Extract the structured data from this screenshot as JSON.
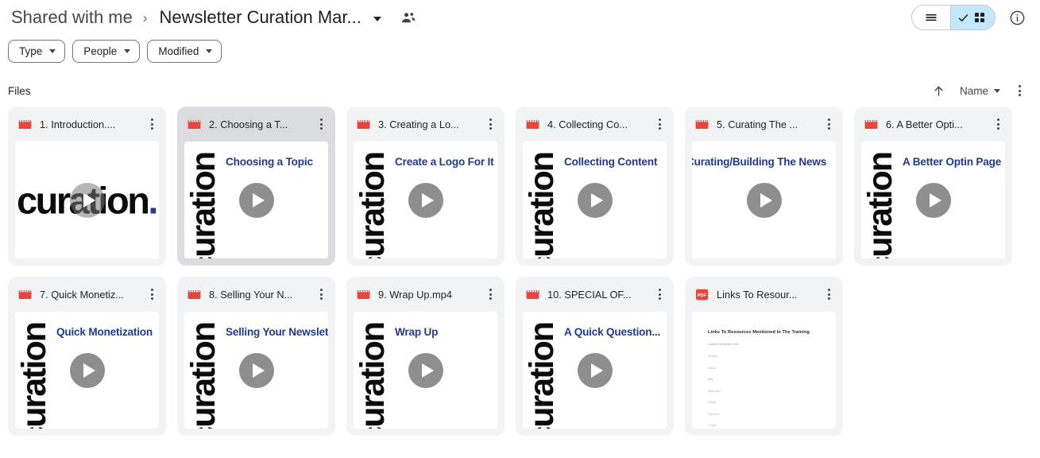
{
  "header": {
    "breadcrumb_root": "Shared with me",
    "breadcrumb_separator": "›",
    "breadcrumb_current": "Newsletter Curation Mar...",
    "people_icon": "people-shared-icon",
    "view_list_icon": "list-view-icon",
    "view_grid_icon": "grid-view-icon",
    "view_grid_selected": true,
    "info_icon": "info-circle-icon"
  },
  "filters": [
    {
      "label": "Type",
      "name": "type"
    },
    {
      "label": "People",
      "name": "people"
    },
    {
      "label": "Modified",
      "name": "modified"
    }
  ],
  "section": {
    "title": "Files",
    "sort_direction_icon": "arrow-up-icon",
    "sort_label": "Name",
    "more_icon": "kebab-menu-icon"
  },
  "files": [
    {
      "name": "1. Introduction....",
      "type_icon": "video-file-icon",
      "selected": false,
      "thumb": {
        "kind": "video",
        "variant": "wordmark-horizontal",
        "wordmark": "curation",
        "title": ""
      }
    },
    {
      "name": "2. Choosing a T...",
      "type_icon": "video-file-icon",
      "selected": true,
      "thumb": {
        "kind": "video",
        "variant": "slide",
        "wordmark": "curation",
        "title": "Choosing a Topic"
      }
    },
    {
      "name": "3. Creating a Lo...",
      "type_icon": "video-file-icon",
      "selected": false,
      "thumb": {
        "kind": "video",
        "variant": "slide",
        "wordmark": "curation",
        "title": "Create a Logo For It"
      }
    },
    {
      "name": "4. Collecting Co...",
      "type_icon": "video-file-icon",
      "selected": false,
      "thumb": {
        "kind": "video",
        "variant": "slide",
        "wordmark": "curation",
        "title": "Collecting Content"
      }
    },
    {
      "name": "5. Curating The ...",
      "type_icon": "video-file-icon",
      "selected": false,
      "thumb": {
        "kind": "video",
        "variant": "shift",
        "wordmark": "",
        "title": "Curating/Building The News"
      }
    },
    {
      "name": "6. A Better Opti...",
      "type_icon": "video-file-icon",
      "selected": false,
      "thumb": {
        "kind": "video",
        "variant": "slide",
        "wordmark": "curation",
        "title": "A Better Optin Page"
      }
    },
    {
      "name": "7. Quick Monetiz...",
      "type_icon": "video-file-icon",
      "selected": false,
      "thumb": {
        "kind": "video",
        "variant": "slide",
        "wordmark": "curation",
        "title": "Quick Monetization"
      }
    },
    {
      "name": "8. Selling Your N...",
      "type_icon": "video-file-icon",
      "selected": false,
      "thumb": {
        "kind": "video",
        "variant": "slide",
        "wordmark": "curation",
        "title": "Selling Your Newslett"
      }
    },
    {
      "name": "9. Wrap Up.mp4",
      "type_icon": "video-file-icon",
      "selected": false,
      "thumb": {
        "kind": "video",
        "variant": "slide",
        "wordmark": "curation",
        "title": "Wrap Up"
      }
    },
    {
      "name": "10. SPECIAL OF...",
      "type_icon": "video-file-icon",
      "selected": false,
      "thumb": {
        "kind": "video",
        "variant": "slide",
        "wordmark": "curation",
        "title": "A Quick Question..."
      }
    },
    {
      "name": "Links To Resour...",
      "type_icon": "pdf-file-icon",
      "selected": false,
      "thumb": {
        "kind": "pdf",
        "heading": "Links To Resources Mentioned In The Training",
        "subheading": "Curation Newsletter Links",
        "lines": [
          "Pixabay",
          "Canva",
          "Bitly",
          "MailChimp",
          "Feedly",
          "Flipboard",
          "Google"
        ]
      }
    }
  ],
  "colors": {
    "accent_selected": "#c2e7ff",
    "video_icon": "#e8453c",
    "pdf_icon": "#e8453c",
    "card_bg": "#f1f3f4",
    "card_bg_selected": "#dadce0",
    "slide_title": "#1f3a93"
  }
}
